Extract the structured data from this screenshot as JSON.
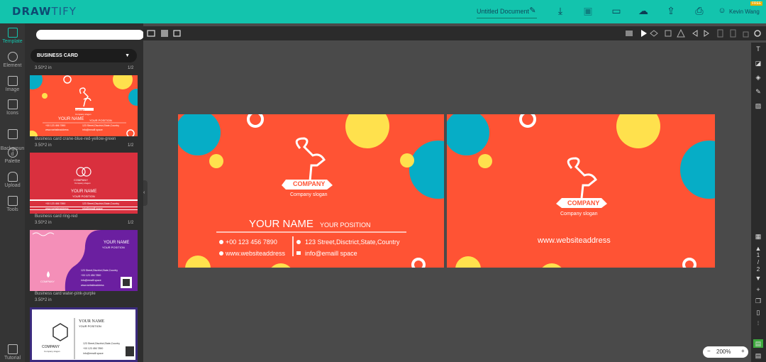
{
  "brand": {
    "logo_bold": "DRAW",
    "logo_light": "TIFY"
  },
  "header": {
    "document_title": "Untitled Document",
    "user_name": "Kevin Wang",
    "badge": "FREE",
    "icons": [
      "pencil-icon",
      "download-icon",
      "save-icon",
      "present-icon",
      "cloud-icon",
      "share-icon",
      "print-icon",
      "user-icon"
    ]
  },
  "left_nav": {
    "items": [
      {
        "label": "Template",
        "icon": "template-icon"
      },
      {
        "label": "Element",
        "icon": "element-icon"
      },
      {
        "label": "Image",
        "icon": "image-icon"
      },
      {
        "label": "Icons",
        "icon": "icons-icon"
      },
      {
        "label": "Backgroun\nd",
        "icon": "background-icon"
      },
      {
        "label": "Palette",
        "icon": "palette-icon"
      },
      {
        "label": "Upload",
        "icon": "upload-icon"
      },
      {
        "label": "Tools",
        "icon": "tools-icon"
      },
      {
        "label": "Tutorial",
        "icon": "tutorial-icon"
      }
    ],
    "active_color": "#13c4ad"
  },
  "panel": {
    "search_placeholder": "",
    "category": "BUSINESS CARD",
    "templates": [
      {
        "size": "3.50*2 in",
        "pages": "1/2",
        "name": "Business card crane-blue-red-yellow-green"
      },
      {
        "size": "3.50*2 in",
        "pages": "1/2",
        "name": "Business card ring-red"
      },
      {
        "size": "3.50*2 in",
        "pages": "1/2",
        "name": "Business card water-pink-purple"
      },
      {
        "size": "3.50*2 in",
        "pages": "",
        "name": ""
      }
    ],
    "thumb_texts": {
      "company": "COMPANY",
      "slogan": "Company slogan",
      "your_name": "YOUR NAME",
      "your_position": "YOUR POSITION",
      "phone": "+00 123 456 7890",
      "street": "123 Street,Disctrict,State,Country",
      "info": "info@emaill space",
      "web": "www.websiteaddress"
    }
  },
  "card_front": {
    "company": "COMPANY",
    "slogan": "Company slogan",
    "your_name": "YOUR NAME",
    "your_position": "YOUR POSITION",
    "phone": "+00 123 456 7890",
    "address": "123 Street,Disctrict,State,Country",
    "website": "www.websiteaddress",
    "email": "info@emaill space"
  },
  "card_back": {
    "company": "COMPANY",
    "slogan": "Company slogan",
    "website": "www.websiteaddress"
  },
  "pagination": {
    "current": "1",
    "sep": "/",
    "total": "2"
  },
  "zoom": {
    "value": "200%",
    "minus": "−",
    "plus": "+"
  },
  "colors": {
    "topbar": "#13c4ad",
    "card_orange": "#ff5334",
    "circle_yellow": "#ffe14d",
    "circle_blue": "#06adc6"
  }
}
